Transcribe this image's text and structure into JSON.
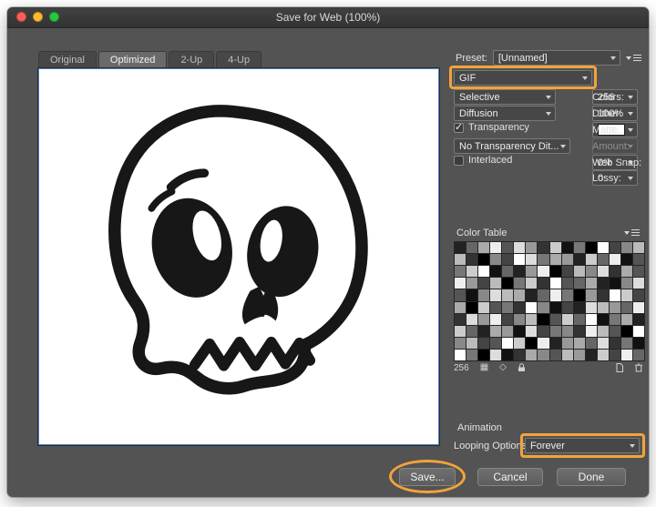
{
  "window": {
    "title": "Save for Web (100%)",
    "traffic_lights": [
      "#ff5f57",
      "#febc2e",
      "#28c840"
    ]
  },
  "tabs": [
    {
      "label": "Original"
    },
    {
      "label": "Optimized"
    },
    {
      "label": "2-Up"
    },
    {
      "label": "4-Up"
    }
  ],
  "settings": {
    "preset": {
      "label": "Preset:",
      "value": "[Unnamed]"
    },
    "format": {
      "value": "GIF"
    },
    "color_reduction": {
      "value": "Selective"
    },
    "colors": {
      "label": "Colors:",
      "value": "256"
    },
    "dither_method": {
      "value": "Diffusion"
    },
    "dither": {
      "label": "Dither:",
      "value": "100%"
    },
    "transparency": {
      "label": "Transparency",
      "checked": true
    },
    "matte": {
      "label": "Matte:",
      "swatch": "#ffffff"
    },
    "transparency_dither": {
      "value": "No Transparency Dit..."
    },
    "amount": {
      "label": "Amount:",
      "value": ""
    },
    "interlaced": {
      "label": "Interlaced",
      "checked": false
    },
    "web_snap": {
      "label": "Web Snap:",
      "value": "0%"
    },
    "lossy": {
      "label": "Lossy:",
      "value": "0"
    }
  },
  "color_table": {
    "label": "Color Table",
    "count": "256",
    "rows": [
      "26ae5d93c170f48b",
      "b3084fd7a92c6e15",
      "7cf1629e04b8d3a5",
      "e94b07c3f56a218d",
      "518dba26e7093fc4",
      "a0c573f8142db96e",
      "3d9e48b05c6f17a2",
      "c62a91d4783eb50f",
      "8b45fc0e29a6d371",
      "f70d13a85b92c4e6"
    ]
  },
  "animation": {
    "label": "Animation",
    "looping": {
      "label": "Looping Options:",
      "value": "Forever"
    }
  },
  "buttons": {
    "save": "Save...",
    "cancel": "Cancel",
    "done": "Done"
  },
  "icons": {
    "check": "✓",
    "map_transparency": "▦",
    "web_shift": "◇"
  },
  "annotation_color": "#F2A33C"
}
